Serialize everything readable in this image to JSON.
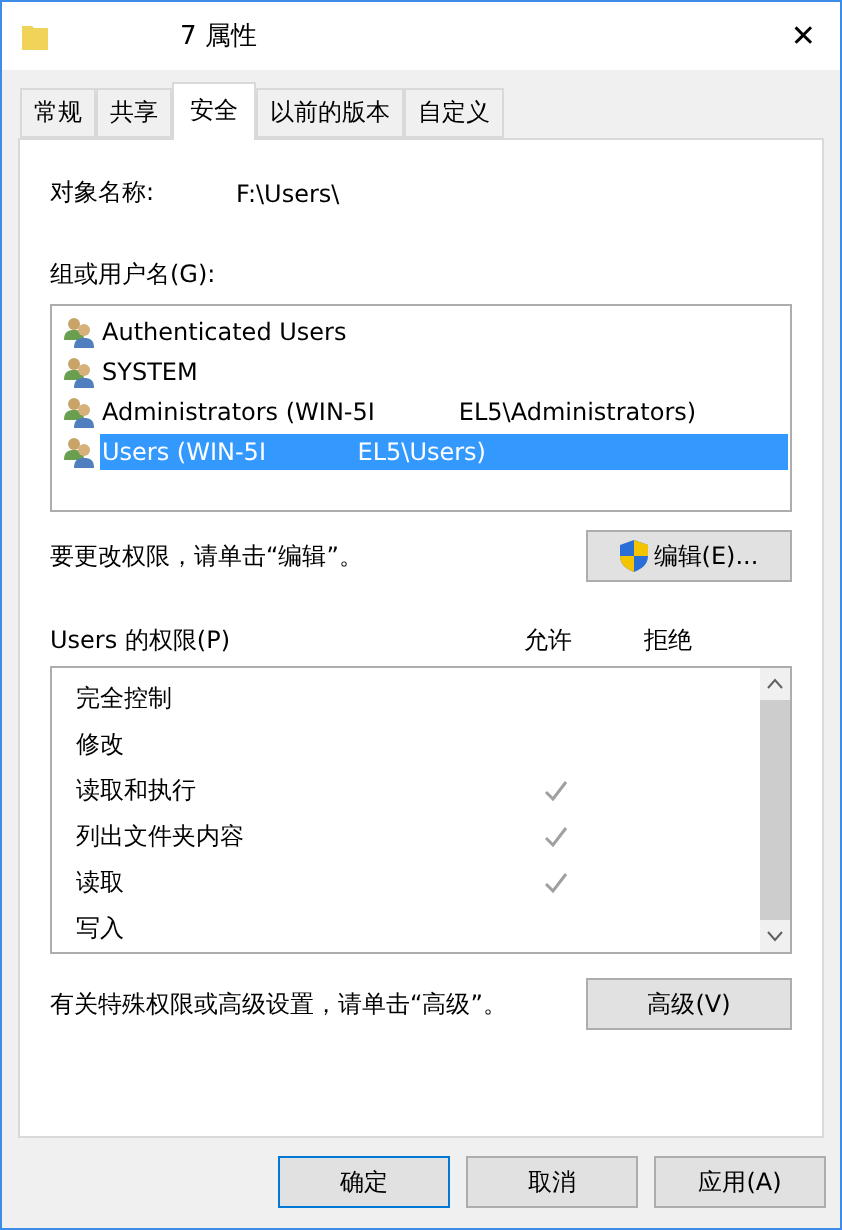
{
  "window": {
    "title": "7 属性",
    "close": "✕"
  },
  "tabs": [
    {
      "label": "常规",
      "selected": false
    },
    {
      "label": "共享",
      "selected": false
    },
    {
      "label": "安全",
      "selected": true
    },
    {
      "label": "以前的版本",
      "selected": false
    },
    {
      "label": "自定义",
      "selected": false
    }
  ],
  "object": {
    "label": "对象名称:",
    "value": "F:\\Users\\"
  },
  "groups": {
    "label": "组或用户名(G):",
    "items": [
      {
        "name": "Authenticated Users",
        "selected": false
      },
      {
        "name": "SYSTEM",
        "selected": false
      },
      {
        "name": "Administrators (WIN-5I           EL5\\Administrators)",
        "selected": false
      },
      {
        "name": "Users (WIN-5I            EL5\\Users)",
        "selected": true
      }
    ]
  },
  "edit_hint": "要更改权限，请单击“编辑”。",
  "edit_button": "编辑(E)...",
  "permissions": {
    "label": "Users 的权限(P)",
    "allow_header": "允许",
    "deny_header": "拒绝",
    "rows": [
      {
        "name": "完全控制",
        "allow": false,
        "deny": false
      },
      {
        "name": "修改",
        "allow": false,
        "deny": false
      },
      {
        "name": "读取和执行",
        "allow": true,
        "deny": false
      },
      {
        "name": "列出文件夹内容",
        "allow": true,
        "deny": false
      },
      {
        "name": "读取",
        "allow": true,
        "deny": false
      },
      {
        "name": "写入",
        "allow": false,
        "deny": false
      }
    ]
  },
  "advanced_hint": "有关特殊权限或高级设置，请单击“高级”。",
  "advanced_button": "高级(V)",
  "buttons": [
    {
      "label": "确定",
      "default": true
    },
    {
      "label": "取消",
      "default": false
    },
    {
      "label": "应用(A)",
      "default": false
    }
  ]
}
